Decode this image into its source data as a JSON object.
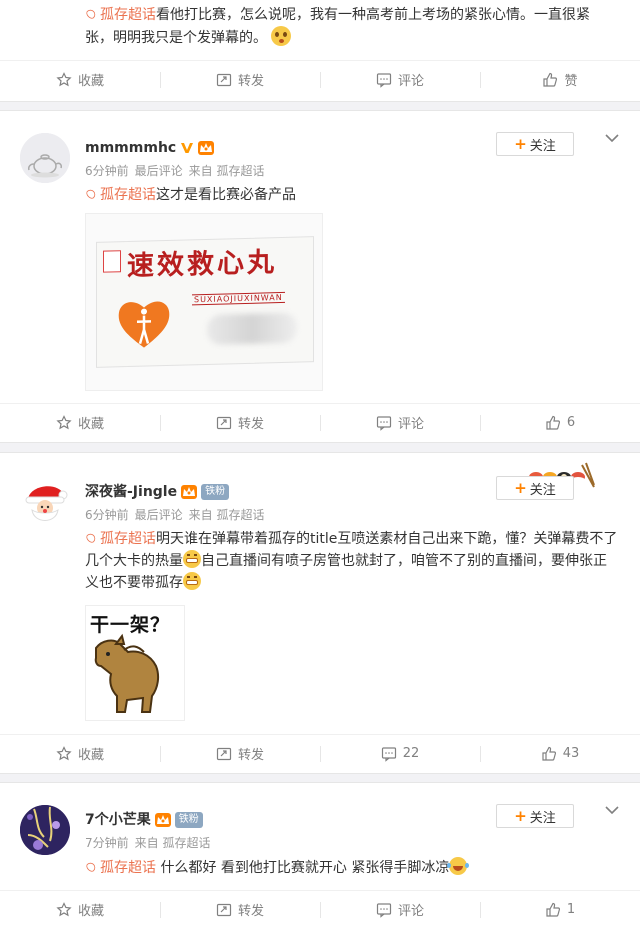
{
  "post0": {
    "topic": "孤存超话",
    "text": "看他打比赛，怎么说呢，我有一种高考前上考场的紧张心情。一直很紧张，明明我只是个发弹幕的。",
    "actions": {
      "favorite": "收藏",
      "repost": "转发",
      "comment": "评论",
      "like": "赞"
    }
  },
  "post1": {
    "username": "mmmmmhc",
    "time": "6分钟前",
    "last_comment": "最后评论",
    "source": "来自 孤存超话",
    "follow": "关注",
    "topic": "孤存超话",
    "text": "这才是看比赛必备产品",
    "image": {
      "title": "速效救心丸",
      "pinyin": "SUXIAOJIUXINWAN"
    },
    "actions": {
      "favorite": "收藏",
      "repost": "转发",
      "comment": "评论",
      "like": "6"
    }
  },
  "post2": {
    "username": "深夜酱-Jingle",
    "fan_badge": "铁粉",
    "time": "6分钟前",
    "last_comment": "最后评论",
    "source": "来自 孤存超话",
    "follow": "关注",
    "topic": "孤存超话",
    "text_1": "明天谁在弹幕带着孤存的title互喷送素材自己出来下跪，懂？关弹幕费不了几个大卡的热量",
    "text_2": "自己直播间有喷子房管也就封了，咱管不了别的直播间，要伸张正义也不要带孤存",
    "image": {
      "caption": "干一架？"
    },
    "actions": {
      "favorite": "收藏",
      "repost": "转发",
      "comment": "22",
      "like": "43"
    }
  },
  "post3": {
    "username": "7个小芒果",
    "fan_badge": "铁粉",
    "time": "7分钟前",
    "source": "来自 孤存超话",
    "follow": "关注",
    "topic": "孤存超话",
    "text": " 什么都好 看到他打比赛就开心  紧张得手脚冰凉",
    "actions": {
      "favorite": "收藏",
      "repost": "转发",
      "comment": "评论",
      "like": "1"
    }
  },
  "colors": {
    "accent": "#eb7350",
    "orange": "#ff8200",
    "muted": "#808080",
    "bg": "#f2f2f5"
  }
}
